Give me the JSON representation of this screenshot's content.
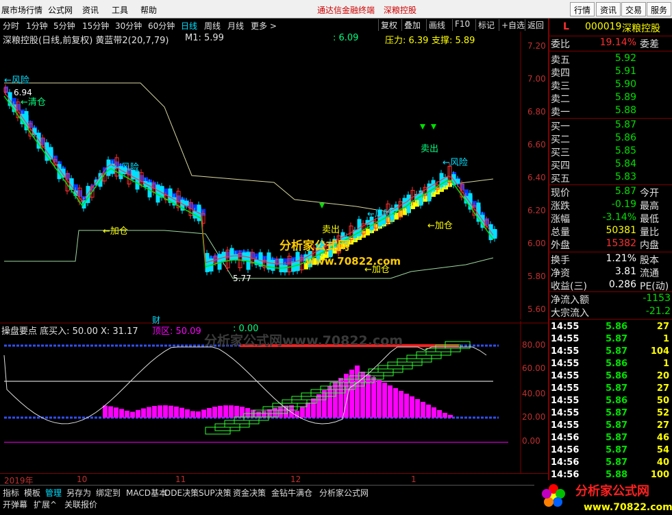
{
  "menu": {
    "items": [
      "展市场行情",
      "公式网",
      "资讯",
      "工具",
      "帮助"
    ],
    "promo": [
      "通达信金融终端",
      "深粮控股"
    ],
    "right_buttons": [
      "行情",
      "资讯",
      "交易",
      "服务"
    ]
  },
  "period_bar": {
    "periods": [
      "分时",
      "1分钟",
      "5分钟",
      "15分钟",
      "30分钟",
      "60分钟",
      "日线",
      "周线",
      "月线",
      "更多 >"
    ],
    "active": "日线",
    "tools": [
      "复权",
      "叠加",
      "画线",
      "F10",
      "标记",
      "+自选",
      "返回"
    ]
  },
  "main_chart": {
    "title": "深粮控股(日线,前复权) 黄蓝带2(20,7,79)",
    "m1": "M1: 5.99",
    "extra": ": 6.09",
    "pressure": "压力: 6.39",
    "support": "支撑: 5.89",
    "high_label": "6.94",
    "low_label": "5.77",
    "price_axis": [
      "7.20",
      "7.00",
      "6.80",
      "6.60",
      "6.40",
      "6.20",
      "6.00",
      "5.80",
      "5.60"
    ],
    "annotations": {
      "risk1": "←风险",
      "clear": "←清仓",
      "risk2": "←风险",
      "add1": "←加仓",
      "sell1": "卖出",
      "risk3": "←风险",
      "add2": "←加仓",
      "add3": "←加仓",
      "sell2": "卖出",
      "risk4": "←风险"
    },
    "watermark1": "分析家公式网",
    "watermark2": "www.70822.com"
  },
  "ind_chart": {
    "title": "操盘要点 底买入: 50.00  X: 31.17",
    "top_area": "顶区: 50.09",
    "zero": ": 0.00",
    "cai": "财",
    "axis": [
      "80.00",
      "60.00",
      "40.00",
      "20.00",
      "0.00"
    ],
    "watermark": "分析家公式网www.70822.com"
  },
  "date_axis": [
    "2019年",
    "10",
    "11",
    "12",
    "1"
  ],
  "tabs": [
    "指标",
    "模板",
    "管理",
    "另存为",
    "绑定到",
    "MACD基本",
    "DDE决策",
    "SUP决策",
    "资金决策",
    "金钻牛满仓",
    "分析家公式网"
  ],
  "tabs_active": "管理",
  "tabs2": [
    "开弹幕",
    "扩展^",
    "关联报价"
  ],
  "right_panel": {
    "mark": "L",
    "code": "000019",
    "name": "深粮控股",
    "weibi_label": "委比",
    "weibi": "19.14%",
    "weicha_label": "委差",
    "asks": [
      {
        "label": "卖五",
        "price": "5.92"
      },
      {
        "label": "卖四",
        "price": "5.91"
      },
      {
        "label": "卖三",
        "price": "5.90"
      },
      {
        "label": "卖二",
        "price": "5.89"
      },
      {
        "label": "卖一",
        "price": "5.88"
      }
    ],
    "bids": [
      {
        "label": "买一",
        "price": "5.87"
      },
      {
        "label": "买二",
        "price": "5.86"
      },
      {
        "label": "买三",
        "price": "5.85"
      },
      {
        "label": "买四",
        "price": "5.84"
      },
      {
        "label": "买五",
        "price": "5.83"
      }
    ],
    "stats": [
      {
        "label": "现价",
        "value": "5.87",
        "label2": "今开",
        "color": "green"
      },
      {
        "label": "涨跌",
        "value": "-0.19",
        "label2": "最高",
        "color": "green"
      },
      {
        "label": "涨幅",
        "value": "-3.14%",
        "label2": "最低",
        "color": "green"
      },
      {
        "label": "总量",
        "value": "50381",
        "label2": "量比",
        "color": "yellow"
      },
      {
        "label": "外盘",
        "value": "15382",
        "label2": "内盘",
        "color": "red"
      }
    ],
    "stats2": [
      {
        "label": "换手",
        "value": "1.21%",
        "label2": "股本"
      },
      {
        "label": "净资",
        "value": "3.81",
        "label2": "流通"
      },
      {
        "label": "收益(三)",
        "value": "0.286",
        "label2": "PE(动)"
      }
    ],
    "flows": [
      {
        "label": "净流入额",
        "value": "-1153"
      },
      {
        "label": "大宗流入",
        "value": "-21.2"
      }
    ],
    "ticks": [
      {
        "time": "14:55",
        "price": "5.86",
        "vol": "27"
      },
      {
        "time": "14:55",
        "price": "5.87",
        "vol": "1"
      },
      {
        "time": "14:55",
        "price": "5.87",
        "vol": "104"
      },
      {
        "time": "14:55",
        "price": "5.86",
        "vol": "1"
      },
      {
        "time": "14:55",
        "price": "5.86",
        "vol": "20"
      },
      {
        "time": "14:55",
        "price": "5.87",
        "vol": "27"
      },
      {
        "time": "14:55",
        "price": "5.86",
        "vol": "50"
      },
      {
        "time": "14:55",
        "price": "5.87",
        "vol": "52"
      },
      {
        "time": "14:55",
        "price": "5.87",
        "vol": "27"
      },
      {
        "time": "14:56",
        "price": "5.87",
        "vol": "46"
      },
      {
        "time": "14:56",
        "price": "5.87",
        "vol": "54"
      },
      {
        "time": "14:56",
        "price": "5.87",
        "vol": "40"
      },
      {
        "time": "14:56",
        "price": "5.88",
        "vol": "100"
      }
    ]
  },
  "logo": {
    "text": "分析家公式网",
    "url": "www.70822.com"
  },
  "colors": {
    "up": "#ff3030",
    "down": "#00e0ff",
    "axis": "#c03030",
    "band_blue": "#0033ff",
    "band_yellow": "#ffff00",
    "magenta": "#ff00ff"
  }
}
